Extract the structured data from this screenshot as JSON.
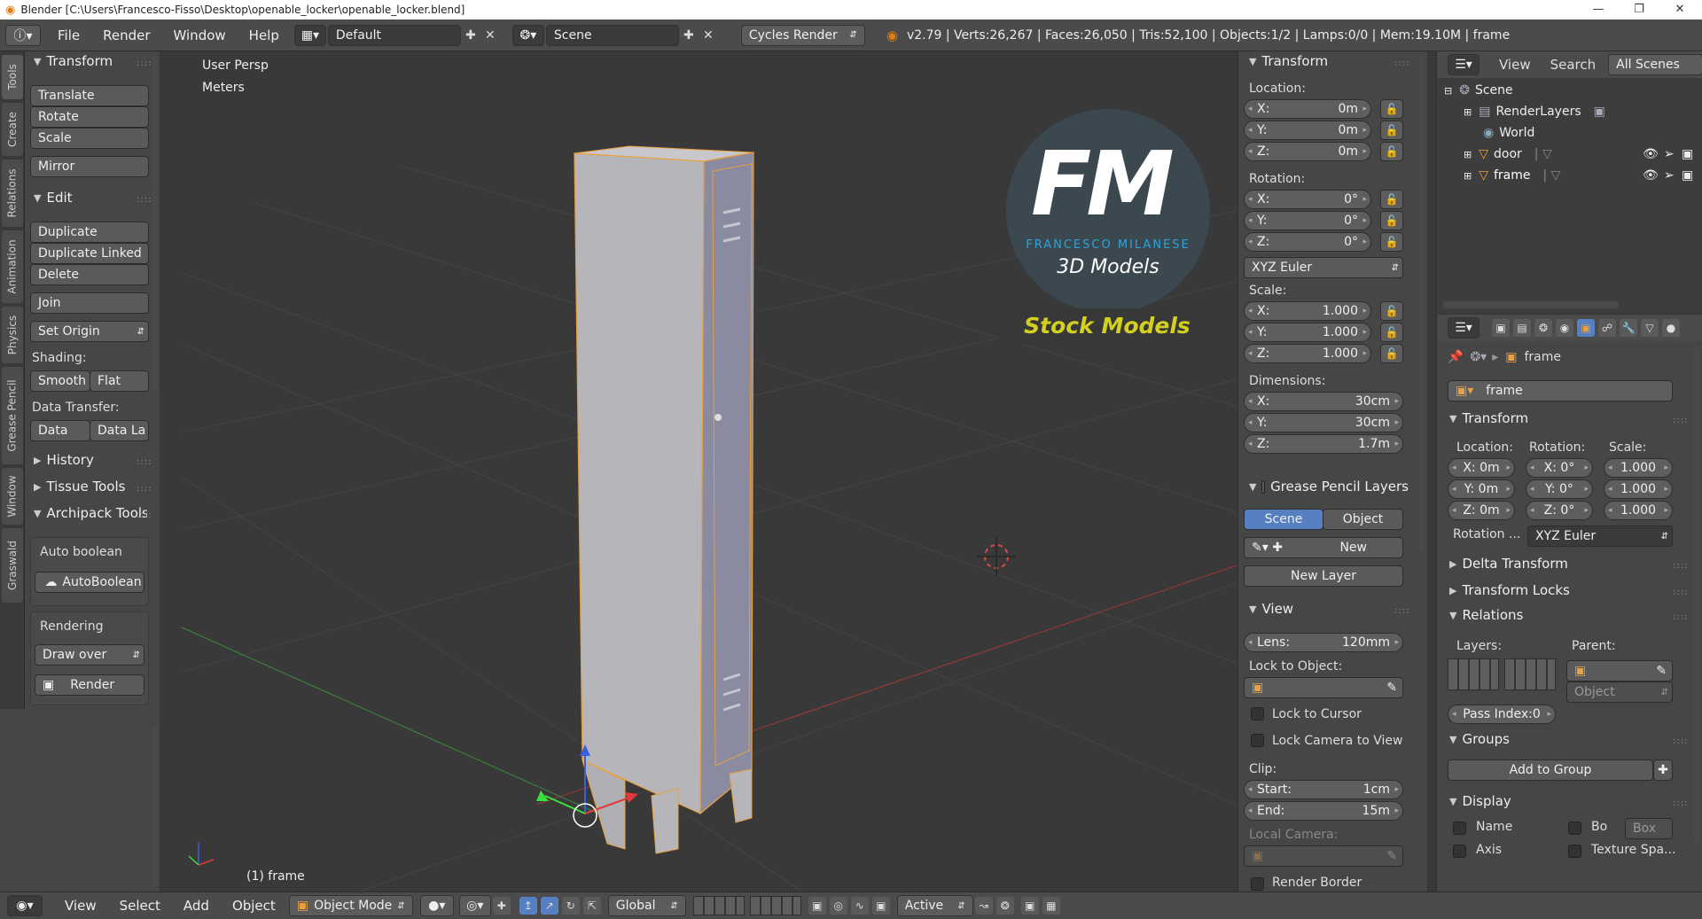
{
  "window": {
    "app_title": "Blender [C:\\Users\\Francesco-Fisso\\Desktop\\openable_locker\\openable_locker.blend]"
  },
  "topbar": {
    "menus": [
      "File",
      "Render",
      "Window",
      "Help"
    ],
    "layout": "Default",
    "scene": "Scene",
    "engine": "Cycles Render",
    "stats": "v2.79 | Verts:26,267 | Faces:26,050 | Tris:52,100 | Objects:1/2 | Lamps:0/0 | Mem:19.10M | frame"
  },
  "lefttabs": [
    "Tools",
    "Create",
    "Relations",
    "Animation",
    "Physics",
    "Grease Pencil",
    "Window",
    "Graswald"
  ],
  "tools": {
    "transform_header": "Transform",
    "translate": "Translate",
    "rotate": "Rotate",
    "scale": "Scale",
    "mirror": "Mirror",
    "edit_header": "Edit",
    "duplicate": "Duplicate",
    "duplicate_linked": "Duplicate Linked",
    "delete": "Delete",
    "join": "Join",
    "set_origin": "Set Origin",
    "shading_label": "Shading:",
    "smooth": "Smooth",
    "flat": "Flat",
    "data_transfer_label": "Data Transfer:",
    "data": "Data",
    "data_la": "Data La",
    "history": "History",
    "tissue_tools": "Tissue Tools",
    "archipack_tools": "Archipack Tools",
    "auto_boolean_label": "Auto boolean",
    "autoboolean_btn": "AutoBoolean",
    "rendering_label": "Rendering",
    "draw_over": "Draw over",
    "render": "Render"
  },
  "viewport": {
    "view_name": "User Persp",
    "units": "Meters",
    "object_label": "(1) frame",
    "watermark": {
      "initials": "FM",
      "brand": "FRANCESCO MILANESE",
      "tagline": "3D Models",
      "stock": "Stock Models"
    }
  },
  "nprops": {
    "transform_header": "Transform",
    "location_label": "Location:",
    "loc": [
      {
        "k": "X:",
        "v": "0m"
      },
      {
        "k": "Y:",
        "v": "0m"
      },
      {
        "k": "Z:",
        "v": "0m"
      }
    ],
    "rotation_label": "Rotation:",
    "rot": [
      {
        "k": "X:",
        "v": "0°"
      },
      {
        "k": "Y:",
        "v": "0°"
      },
      {
        "k": "Z:",
        "v": "0°"
      }
    ],
    "rot_mode": "XYZ Euler",
    "scale_label": "Scale:",
    "scale": [
      {
        "k": "X:",
        "v": "1.000"
      },
      {
        "k": "Y:",
        "v": "1.000"
      },
      {
        "k": "Z:",
        "v": "1.000"
      }
    ],
    "dimensions_label": "Dimensions:",
    "dim": [
      {
        "k": "X:",
        "v": "30cm"
      },
      {
        "k": "Y:",
        "v": "30cm"
      },
      {
        "k": "Z:",
        "v": "1.7m"
      }
    ],
    "gp_header": "Grease Pencil Layers",
    "scene_tab": "Scene",
    "object_tab": "Object",
    "new_btn": "New",
    "new_layer": "New Layer",
    "view_header": "View",
    "lens": {
      "k": "Lens:",
      "v": "120mm"
    },
    "lock_to_object_label": "Lock to Object:",
    "lock_to_cursor": "Lock to Cursor",
    "lock_camera": "Lock Camera to View",
    "clip_label": "Clip:",
    "clip_start": {
      "k": "Start:",
      "v": "1cm"
    },
    "clip_end": {
      "k": "End:",
      "v": "15m"
    },
    "local_camera_label": "Local Camera:",
    "render_border": "Render Border"
  },
  "outliner": {
    "view": "View",
    "search": "Search",
    "scope": "All Scenes",
    "items": [
      {
        "label": "Scene",
        "indent": 0
      },
      {
        "label": "RenderLayers",
        "indent": 1
      },
      {
        "label": "World",
        "indent": 1
      },
      {
        "label": "door",
        "indent": 1
      },
      {
        "label": "frame",
        "indent": 1
      }
    ]
  },
  "props": {
    "breadcrumb": "frame",
    "object_name": "frame",
    "transform_header": "Transform",
    "location_label": "Location:",
    "rotation_label": "Rotation:",
    "scale_label": "Scale:",
    "loc": [
      "X: 0m",
      "Y: 0m",
      "Z: 0m"
    ],
    "rot": [
      "X:  0°",
      "Y:  0°",
      "Z:  0°"
    ],
    "scl": [
      "1.000",
      "1.000",
      "1.000"
    ],
    "rotation_mode_label": "Rotation ...",
    "rotation_mode": "XYZ Euler",
    "delta_transform": "Delta Transform",
    "transform_locks": "Transform Locks",
    "relations": "Relations",
    "layers_label": "Layers:",
    "parent_label": "Parent:",
    "parent_type": "Object",
    "pass_index": "Pass Index:0",
    "groups": "Groups",
    "add_to_group": "Add to Group",
    "display": "Display",
    "name": "Name",
    "bo": "Bo",
    "box": "Box",
    "axis": "Axis",
    "texture_space": "Texture Spa..."
  },
  "bottombar": {
    "view": "View",
    "select": "Select",
    "add": "Add",
    "object": "Object",
    "mode": "Object Mode",
    "orientation": "Global",
    "pivot": "Active"
  },
  "colors": {
    "accent": "#5680c2",
    "selection": "#e8a040",
    "brand": "#2ea3d8",
    "stock": "#d4d020"
  }
}
